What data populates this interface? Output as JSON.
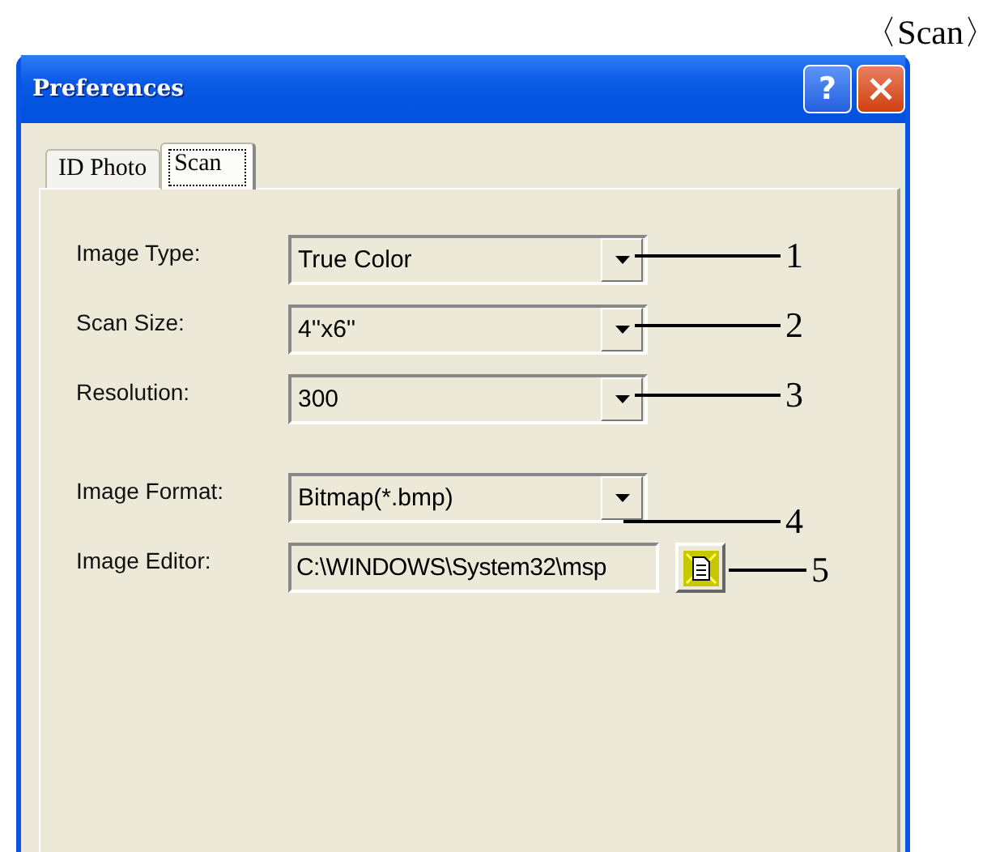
{
  "heading": "〈Scan〉",
  "window": {
    "title": "Preferences",
    "buttons": [
      {
        "kind": "help",
        "label": "?"
      },
      {
        "kind": "close"
      }
    ]
  },
  "tabs": [
    {
      "label": "ID Photo",
      "selected": false
    },
    {
      "label": "Scan",
      "selected": true
    }
  ],
  "groups": [
    [
      {
        "label": "Image Type:",
        "kind": "combo",
        "value": "True Color",
        "callout": "1"
      },
      {
        "label": "Scan Size:",
        "kind": "combo",
        "value": "4''x6''",
        "callout": "2"
      },
      {
        "label": "Resolution:",
        "kind": "combo",
        "value": "300",
        "callout": "3"
      }
    ],
    [
      {
        "label": "Image Format:",
        "kind": "combo",
        "value": "Bitmap(*.bmp)",
        "callout": "4"
      },
      {
        "label": "Image Editor:",
        "kind": "path",
        "value": "C:\\WINDOWS\\System32\\msp",
        "callout": "5"
      }
    ]
  ]
}
